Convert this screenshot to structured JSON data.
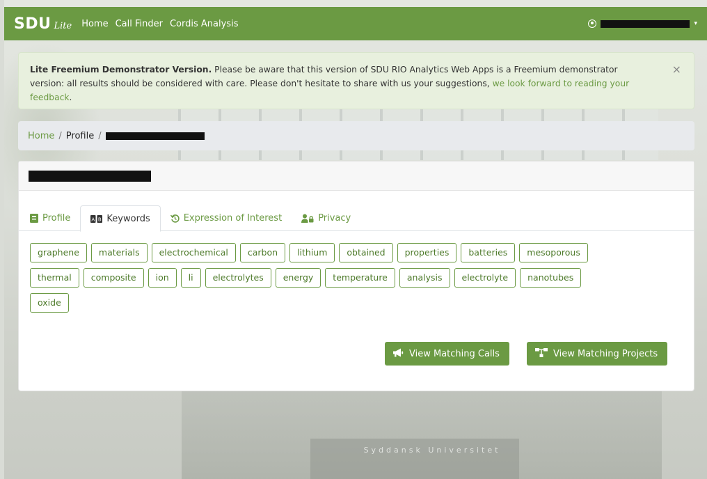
{
  "navbar": {
    "brand": "SDU",
    "brand_sub": "Lite",
    "links": [
      "Home",
      "Call Finder",
      "Cordis Analysis"
    ],
    "user_caret": "▾"
  },
  "alert": {
    "title": "Lite Freemium Demonstrator Version.",
    "body": " Please be aware that this version of SDU RIO Analytics Web Apps is a Freemium demonstrator version: all results should be considered with care. Please don't hesitate to share with us your suggestions, ",
    "link": "we look forward to reading your feedback",
    "end": ".",
    "close": "×"
  },
  "breadcrumb": {
    "home": "Home",
    "sep": "/",
    "profile": "Profile"
  },
  "tabs": [
    {
      "label": "Profile",
      "icon": "id-card-icon"
    },
    {
      "label": "Keywords",
      "icon": "keyword-icon"
    },
    {
      "label": "Expression of Interest",
      "icon": "history-icon"
    },
    {
      "label": "Privacy",
      "icon": "user-lock-icon"
    }
  ],
  "keywords": [
    "graphene",
    "materials",
    "electrochemical",
    "carbon",
    "lithium",
    "obtained",
    "properties",
    "batteries",
    "mesoporous",
    "thermal",
    "composite",
    "ion",
    "li",
    "electrolytes",
    "energy",
    "temperature",
    "analysis",
    "electrolyte",
    "nanotubes",
    "oxide"
  ],
  "buttons": {
    "calls": "View Matching Calls",
    "projects": "View Matching Projects"
  },
  "background": {
    "sign": "Syddansk Universitet"
  },
  "colors": {
    "primary": "#6b9a43",
    "alert_bg": "#e8f0de"
  }
}
